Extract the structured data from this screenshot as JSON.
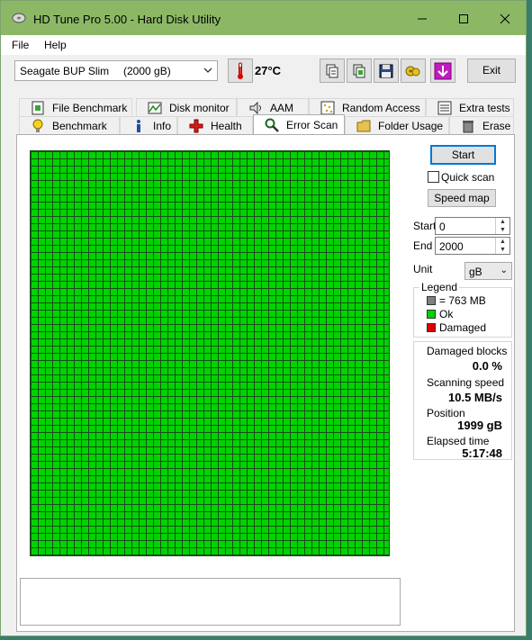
{
  "window": {
    "title": "HD Tune Pro 5.00 - Hard Disk Utility",
    "controls": {
      "minimize": "—",
      "maximize": "☐",
      "close": "✕"
    }
  },
  "menu": {
    "file": "File",
    "help": "Help"
  },
  "toolbar": {
    "drive_name": "Seagate BUP Slim",
    "drive_size": "(2000 gB)",
    "temperature": "27°C",
    "exit_label": "Exit",
    "icons": [
      "copy-icon",
      "copy-all-icon",
      "save-icon",
      "options-icon",
      "download-icon"
    ]
  },
  "tabs_row1": [
    {
      "label": "File Benchmark",
      "icon": "file-benchmark-icon"
    },
    {
      "label": "Disk monitor",
      "icon": "disk-monitor-icon"
    },
    {
      "label": "AAM",
      "icon": "speaker-icon"
    },
    {
      "label": "Random Access",
      "icon": "random-access-icon"
    },
    {
      "label": "Extra tests",
      "icon": "extra-tests-icon"
    }
  ],
  "tabs_row2": [
    {
      "label": "Benchmark",
      "icon": "bulb-icon"
    },
    {
      "label": "Info",
      "icon": "info-icon"
    },
    {
      "label": "Health",
      "icon": "health-cross-icon"
    },
    {
      "label": "Error Scan",
      "icon": "magnifier-icon",
      "active": true
    },
    {
      "label": "Folder Usage",
      "icon": "folder-icon"
    },
    {
      "label": "Erase",
      "icon": "trash-icon"
    }
  ],
  "scan": {
    "start_button": "Start",
    "quick_scan_label": "Quick scan",
    "quick_scan_checked": false,
    "speed_map_button": "Speed map",
    "start_label": "Start",
    "start_value": "0",
    "end_label": "End",
    "end_value": "2000",
    "unit_label": "Unit",
    "unit_value": "gB"
  },
  "legend": {
    "title": "Legend",
    "items": [
      {
        "label": "= 763 MB",
        "color": "#808080"
      },
      {
        "label": "Ok",
        "color": "#00d300"
      },
      {
        "label": "Damaged",
        "color": "#e00000"
      }
    ]
  },
  "stats": {
    "damaged_blocks_label": "Damaged blocks",
    "damaged_blocks_value": "0.0 %",
    "scanning_speed_label": "Scanning speed",
    "scanning_speed_value": "10.5 MB/s",
    "position_label": "Position",
    "position_value": "1999 gB",
    "elapsed_label": "Elapsed time",
    "elapsed_value": "5:17:48"
  },
  "colors": {
    "titlebar": "#8cb866",
    "ok_block": "#00d300",
    "grid_line": "#1b4d1b"
  }
}
